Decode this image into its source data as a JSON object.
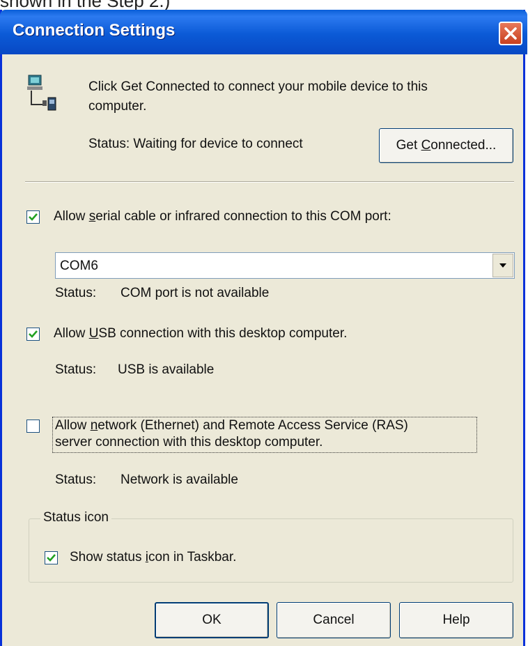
{
  "caption": "shown in the Step 2.)",
  "window": {
    "title": "Connection Settings"
  },
  "intro": {
    "text_line1": "Click Get Connected to connect your mobile device to this",
    "text_line2": "computer.",
    "status": "Status: Waiting for device to connect",
    "get_connected": {
      "label_pre": "Get ",
      "label_u": "C",
      "label_post": "onnected..."
    }
  },
  "serial": {
    "checked": true,
    "label_pre": "Allow ",
    "label_u": "s",
    "label_post": "erial cable or infrared connection to this COM port:",
    "port": "COM6",
    "status_label": "Status:",
    "status_value": "COM port is not available"
  },
  "usb": {
    "checked": true,
    "label_pre": "Allow ",
    "label_u": "U",
    "label_post": "SB connection with this desktop computer.",
    "status_label": "Status:",
    "status_value": "USB is available"
  },
  "network": {
    "checked": false,
    "line1_pre": "Allow ",
    "line1_u": "n",
    "line1_post": "etwork (Ethernet) and Remote Access Service (RAS)",
    "line2": "server connection with this desktop computer.",
    "status_label": "Status:",
    "status_value": "Network is available"
  },
  "status_icon_group": {
    "legend": "Status icon",
    "checked": true,
    "label_pre": "Show status ",
    "label_u": "i",
    "label_post": "con in Taskbar."
  },
  "buttons": {
    "ok": "OK",
    "cancel": "Cancel",
    "help": "Help"
  },
  "icons": {
    "device": "computer-device-icon",
    "close": "close-icon",
    "dropdown": "chevron-down-icon",
    "check": "checkmark-icon"
  }
}
